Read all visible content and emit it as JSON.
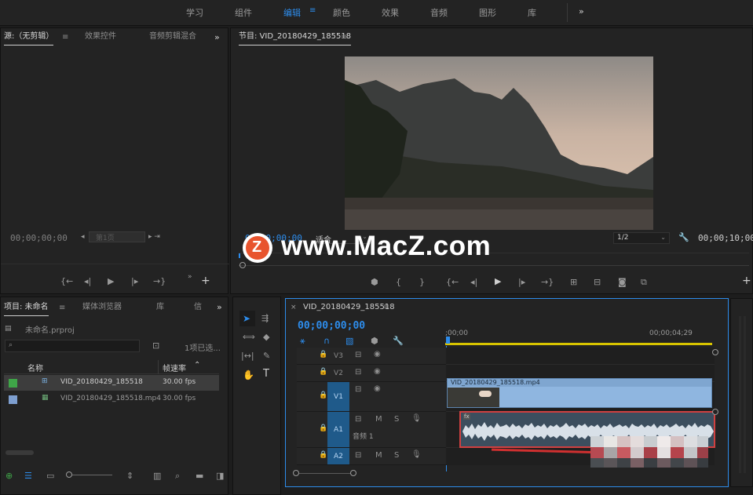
{
  "workspaces": [
    {
      "label": "学习"
    },
    {
      "label": "组件"
    },
    {
      "label": "编辑"
    },
    {
      "label": "颜色"
    },
    {
      "label": "效果"
    },
    {
      "label": "音频"
    },
    {
      "label": "图形"
    },
    {
      "label": "库"
    }
  ],
  "workspace_more": "»",
  "source_panel": {
    "tabs": [
      "源:（无剪辑）",
      "效果控件",
      "音频剪辑混合"
    ],
    "timecode": "00;00;00;00",
    "page_field": "第1页"
  },
  "program_panel": {
    "tab": "节目: VID_20180429_185518",
    "timecode": "00;00;00;00",
    "fit_label": "适合",
    "resolution": "1/2",
    "duration": "00;00;10;00"
  },
  "project_panel": {
    "tabs": [
      "项目: 未命名",
      "媒体浏览器",
      "库",
      "信"
    ],
    "project_file": "未命名.prproj",
    "search_placeholder": "",
    "selection_info": "1项已选...",
    "columns": {
      "name": "名称",
      "fps": "帧速率"
    },
    "items": [
      {
        "name": "VID_20180429_185518",
        "fps": "30.00 fps",
        "color": "#3fa548",
        "selected": true
      },
      {
        "name": "VID_20180429_185518.mp4",
        "fps": "30.00 fps",
        "color": "#7e9fd0",
        "selected": false
      }
    ]
  },
  "timeline": {
    "tab": "VID_20180429_185518",
    "timecode": "00;00;00;00",
    "ruler_start": ";00;00",
    "ruler_mark": "00;00;04;29",
    "tracks": [
      {
        "label": "V3",
        "kind": "video"
      },
      {
        "label": "V2",
        "kind": "video"
      },
      {
        "label": "V1",
        "kind": "video"
      },
      {
        "label": "A1",
        "kind": "audio",
        "name": "音频 1"
      },
      {
        "label": "A2",
        "kind": "audio"
      }
    ],
    "clip_name": "VID_20180429_185518.mp4",
    "clip_audio_badge": "fx",
    "mute_label": "M",
    "solo_label": "S"
  },
  "watermark": {
    "logo_letter": "Z",
    "text": "www.MacZ.com"
  },
  "colors": {
    "accent": "#2d8ceb",
    "video_clip": "#8fb6e0",
    "audio_clip": "#3c4e5e",
    "audio_outline": "#d04040"
  }
}
